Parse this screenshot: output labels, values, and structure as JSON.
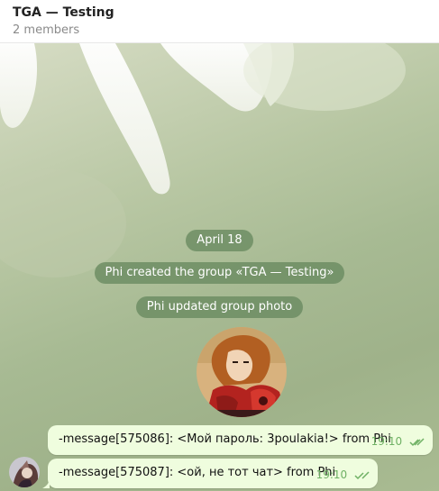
{
  "header": {
    "title": "TGA — Testing",
    "subtitle": "2 members"
  },
  "service": {
    "date": "April 18",
    "created": "Phi created the group «TGA — Testing»",
    "photo_updated": "Phi updated group photo"
  },
  "messages": [
    {
      "text": "-message[575086]: <Мой пароль: 3poulakia!> from Phi",
      "time": "19:10",
      "status_icon": "double-check-icon"
    },
    {
      "text": "-message[575087]: <ой, не тот чат> from Phi",
      "time": "19:10",
      "status_icon": "double-check-icon"
    }
  ],
  "colors": {
    "bubble": "#effdde",
    "time": "#6fb164",
    "service_pill": "#68895f"
  }
}
